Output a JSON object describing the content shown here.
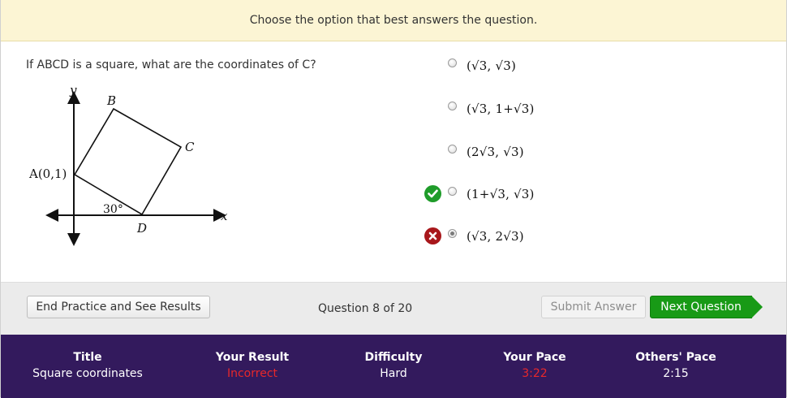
{
  "banner": {
    "text": "Choose the option that best answers the question."
  },
  "question": {
    "text": "If ABCD is a square, what are the coordinates of C?"
  },
  "diagram": {
    "y_axis_label": "y",
    "x_axis_label": "x",
    "point_a_label": "A(0,1)",
    "point_b_label": "B",
    "point_c_label": "C",
    "point_d_label": "D",
    "angle_label": "30°"
  },
  "options": [
    {
      "text": "(√3, √3)",
      "checked": false,
      "mark": ""
    },
    {
      "text": "(√3, 1+√3)",
      "checked": false,
      "mark": ""
    },
    {
      "text": "(2√3, √3)",
      "checked": false,
      "mark": ""
    },
    {
      "text": "(1+√3, √3)",
      "checked": false,
      "mark": "check-icon"
    },
    {
      "text": "(√3, 2√3)",
      "checked": true,
      "mark": "x-icon"
    }
  ],
  "nav": {
    "end_label": "End Practice and See Results",
    "counter": "Question 8 of 20",
    "submit_label": "Submit Answer",
    "next_label": "Next Question"
  },
  "stats": {
    "title_header": "Title",
    "title_value": "Square coordinates",
    "result_header": "Your Result",
    "result_value": "Incorrect",
    "difficulty_header": "Difficulty",
    "difficulty_value": "Hard",
    "pace_header": "Your Pace",
    "pace_value": "3:22",
    "others_header": "Others' Pace",
    "others_value": "2:15"
  },
  "colors": {
    "banner_bg": "#fcf5d4",
    "correct_green": "#1f9c2a",
    "incorrect_red": "#a8171b",
    "next_button": "#189a16",
    "stats_bg": "#331a5d",
    "stat_red": "#e8282a"
  }
}
